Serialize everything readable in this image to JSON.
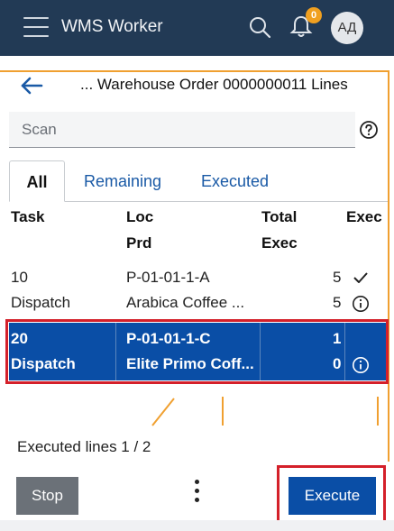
{
  "header": {
    "app_title": "WMS Worker",
    "notification_count": "0",
    "avatar_initials": "АД",
    "icons": [
      "menu-icon",
      "search-icon",
      "bell-icon"
    ]
  },
  "page": {
    "title": "... Warehouse Order 0000000011 Lines",
    "back_icon": "arrow-left-icon"
  },
  "scan": {
    "placeholder": "Scan",
    "help_icon": "question-circle-icon"
  },
  "tabs": [
    {
      "label": "All",
      "active": true
    },
    {
      "label": "Remaining",
      "active": false
    },
    {
      "label": "Executed",
      "active": false
    }
  ],
  "table": {
    "headers": {
      "task": "Task",
      "loc": "Loc",
      "prd": "Prd",
      "total": "Total",
      "exec_sub": "Exec",
      "exec": "Exec"
    },
    "rows": [
      {
        "task": "10",
        "type": "Dispatch",
        "loc": "P-01-01-1-A",
        "prd": "Arabica Coffee ...",
        "total": "5",
        "exec": "5",
        "status_icon": "check-icon",
        "info_icon": "info-icon",
        "selected": false
      },
      {
        "task": "20",
        "type": "Dispatch",
        "loc": "P-01-01-1-C",
        "prd": "Elite Primo Coff...",
        "total": "1",
        "exec": "0",
        "status_icon": "",
        "info_icon": "info-icon",
        "selected": true
      }
    ]
  },
  "status": {
    "text": "Executed lines 1 / 2"
  },
  "footer": {
    "stop_label": "Stop",
    "execute_label": "Execute",
    "more_icon": "more-vertical-icon"
  },
  "colors": {
    "header_bg": "#223a55",
    "accent": "#0a4ea6",
    "badge": "#f0a020",
    "highlight_outline": "#d4202a",
    "guide_lines": "#f0a030"
  }
}
